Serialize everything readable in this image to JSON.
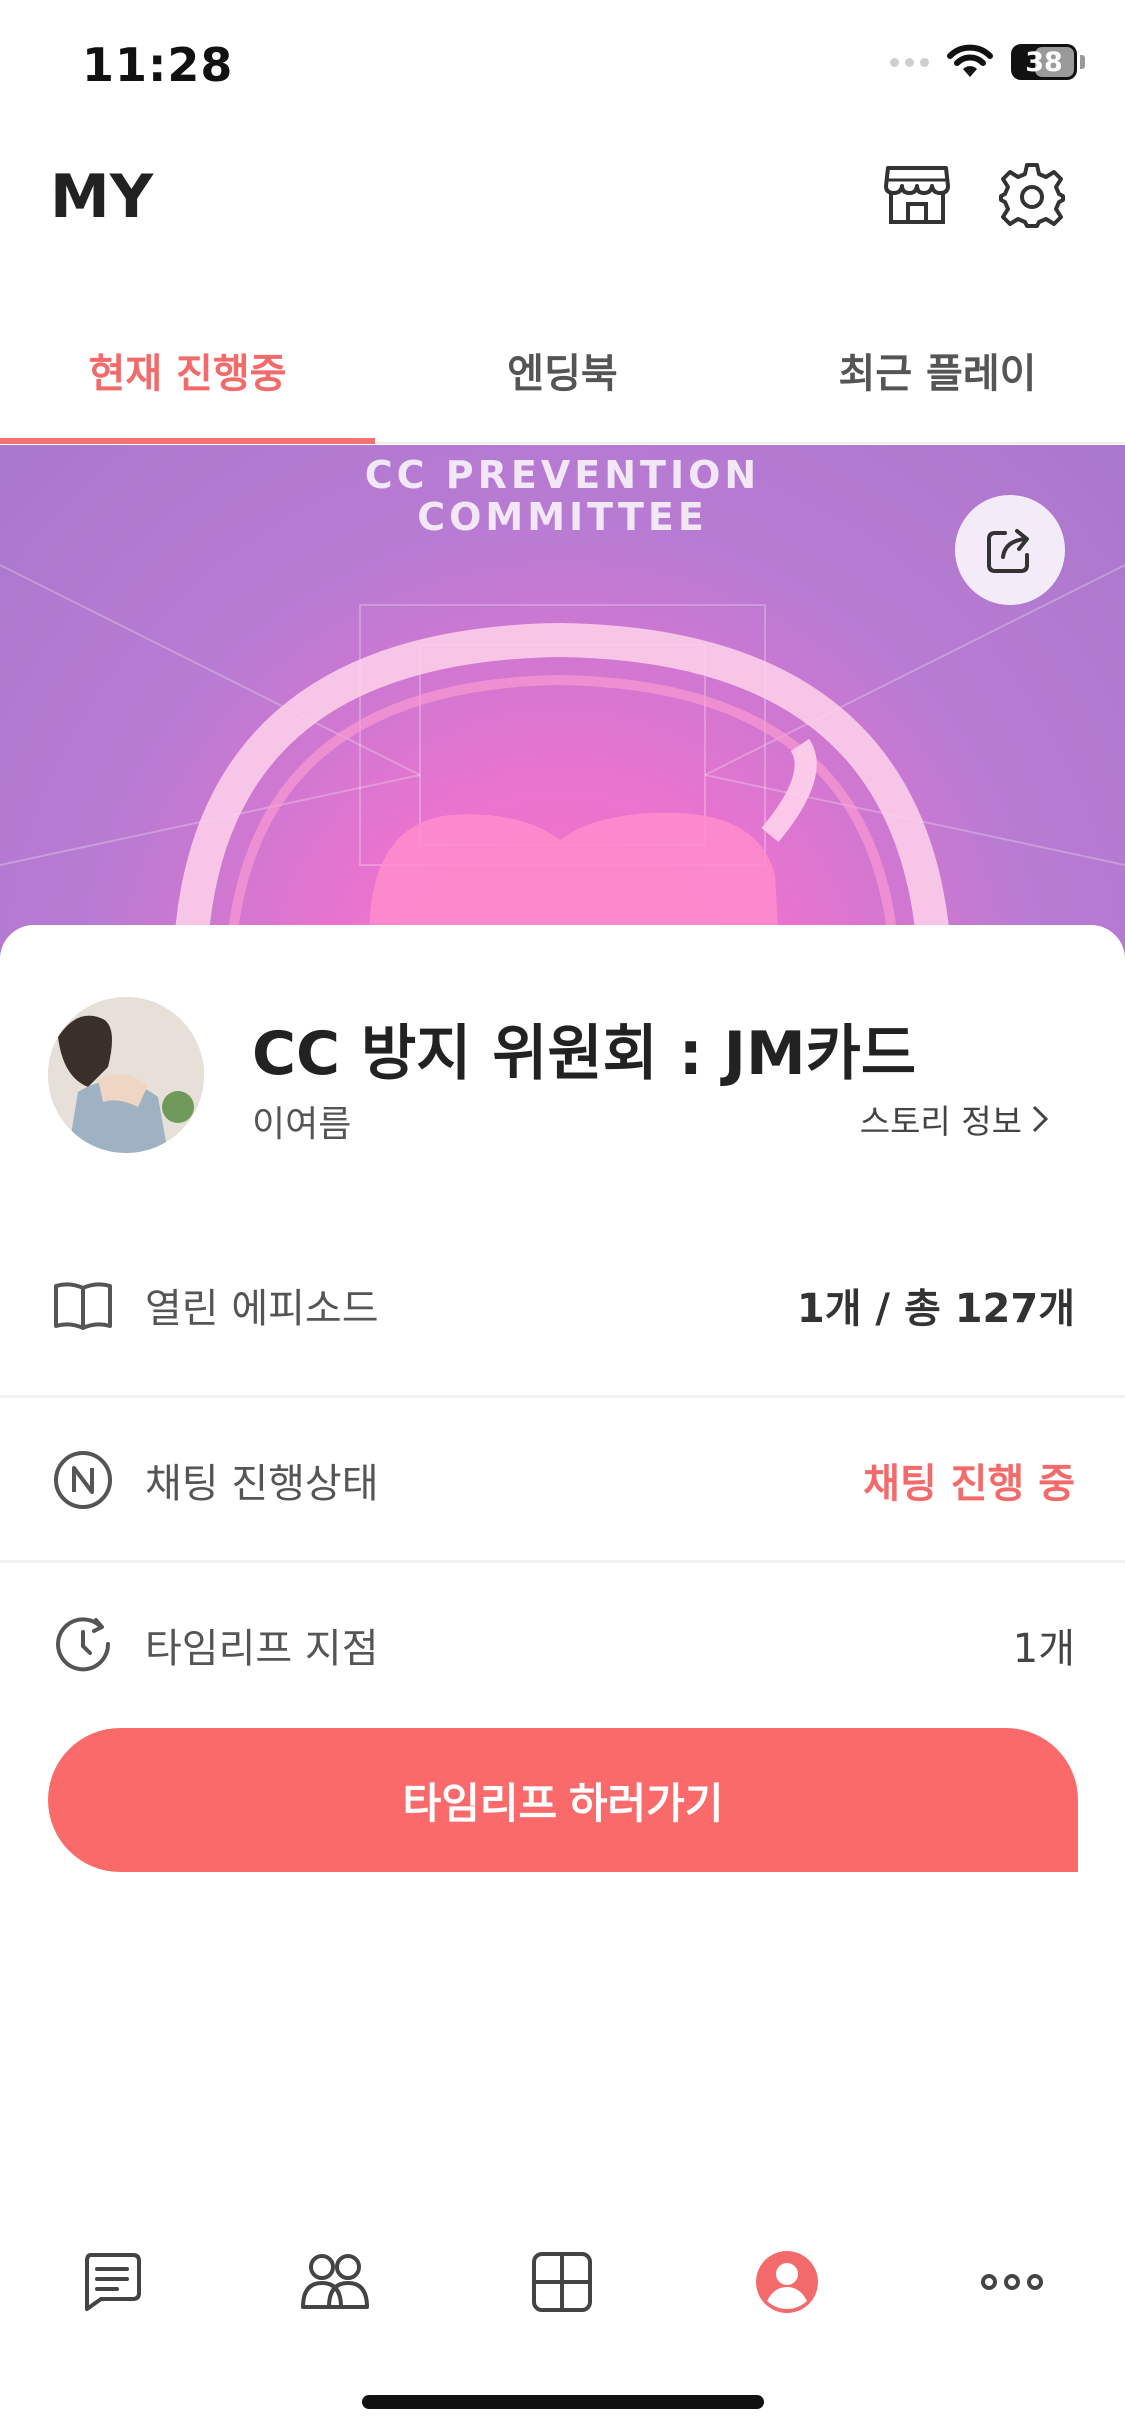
{
  "status_bar": {
    "time": "11:28",
    "battery": "38"
  },
  "header": {
    "title": "MY",
    "icons": [
      "store-icon",
      "gear-icon"
    ]
  },
  "tabs": [
    {
      "label": "현재 진행중",
      "active": true
    },
    {
      "label": "엔딩북",
      "active": false
    },
    {
      "label": "최근 플레이",
      "active": false
    }
  ],
  "banner": {
    "line1": "CC PREVENTION",
    "line2": "COMMITTEE",
    "share_icon": "share-icon"
  },
  "story": {
    "title": "CC 방지 위원회 : JM카드",
    "author": "이여름",
    "info_link": "스토리 정보"
  },
  "rows": [
    {
      "icon": "book-icon",
      "label": "열린 에피소드",
      "value": "1개 / 총 127개"
    },
    {
      "icon": "n-circle-icon",
      "label": "채팅 진행상태",
      "value": "채팅 진행 중"
    },
    {
      "icon": "timer-icon",
      "label": "타임리프 지점",
      "value": "1개"
    }
  ],
  "cta": {
    "label": "타임리프 하러가기"
  },
  "colors": {
    "accent": "#f26a6a",
    "button": "#fb6a6a"
  },
  "bottom_nav": [
    "chat-icon",
    "people-icon",
    "grid-icon",
    "profile-icon",
    "more-icon"
  ]
}
